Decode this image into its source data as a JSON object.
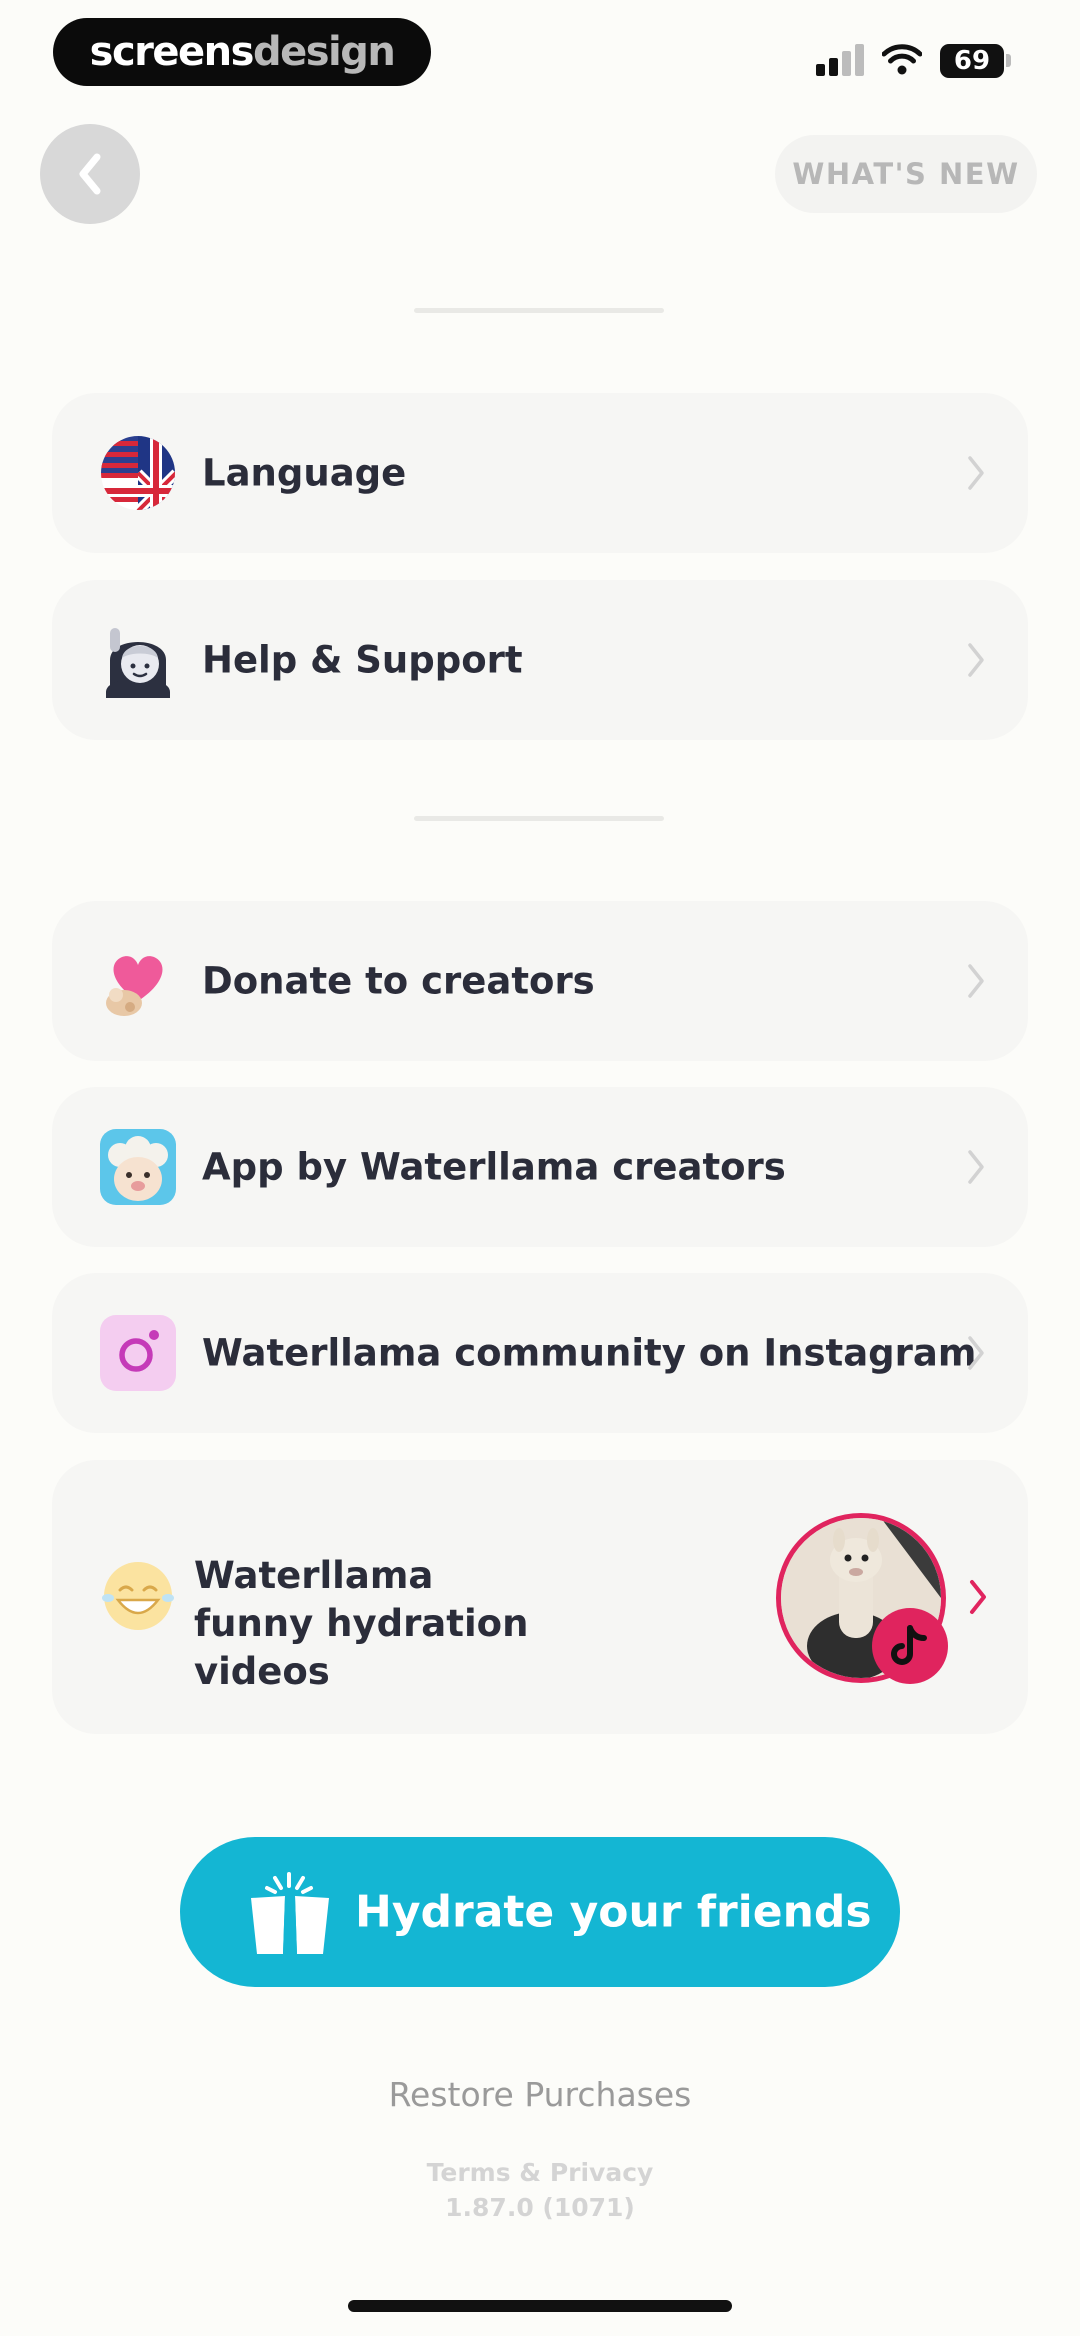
{
  "status_bar": {
    "brand_bold": "screens",
    "brand_light": "design",
    "battery": "69"
  },
  "nav": {
    "back_icon": "chevron-left-icon",
    "whats_new_label": "WHAT'S NEW"
  },
  "menu": {
    "language": {
      "label": "Language",
      "icon": "us-uk-flag-icon"
    },
    "help": {
      "label": "Help & Support",
      "icon": "support-agent-icon"
    },
    "donate": {
      "label": "Donate to creators",
      "icon": "heart-llama-icon"
    },
    "app": {
      "label": "App by Waterllama creators",
      "icon": "sheep-app-icon"
    },
    "instagram": {
      "label": "Waterllama community on Instagram",
      "icon": "instagram-icon"
    },
    "videos": {
      "label": "Waterllama funny hydration videos",
      "icon": "laughing-emoji-icon",
      "badge_icon": "tiktok-icon"
    }
  },
  "cta": {
    "label": "Hydrate your friends",
    "icon": "gift-icon",
    "color": "#14b6d3"
  },
  "footer": {
    "restore": "Restore Purchases",
    "terms": "Terms & Privacy",
    "version": "1.87.0 (1071)"
  },
  "colors": {
    "background": "#fcfcf9",
    "card": "#f6f6f4",
    "text": "#2b2d3a",
    "accent_pink": "#e0245e"
  }
}
